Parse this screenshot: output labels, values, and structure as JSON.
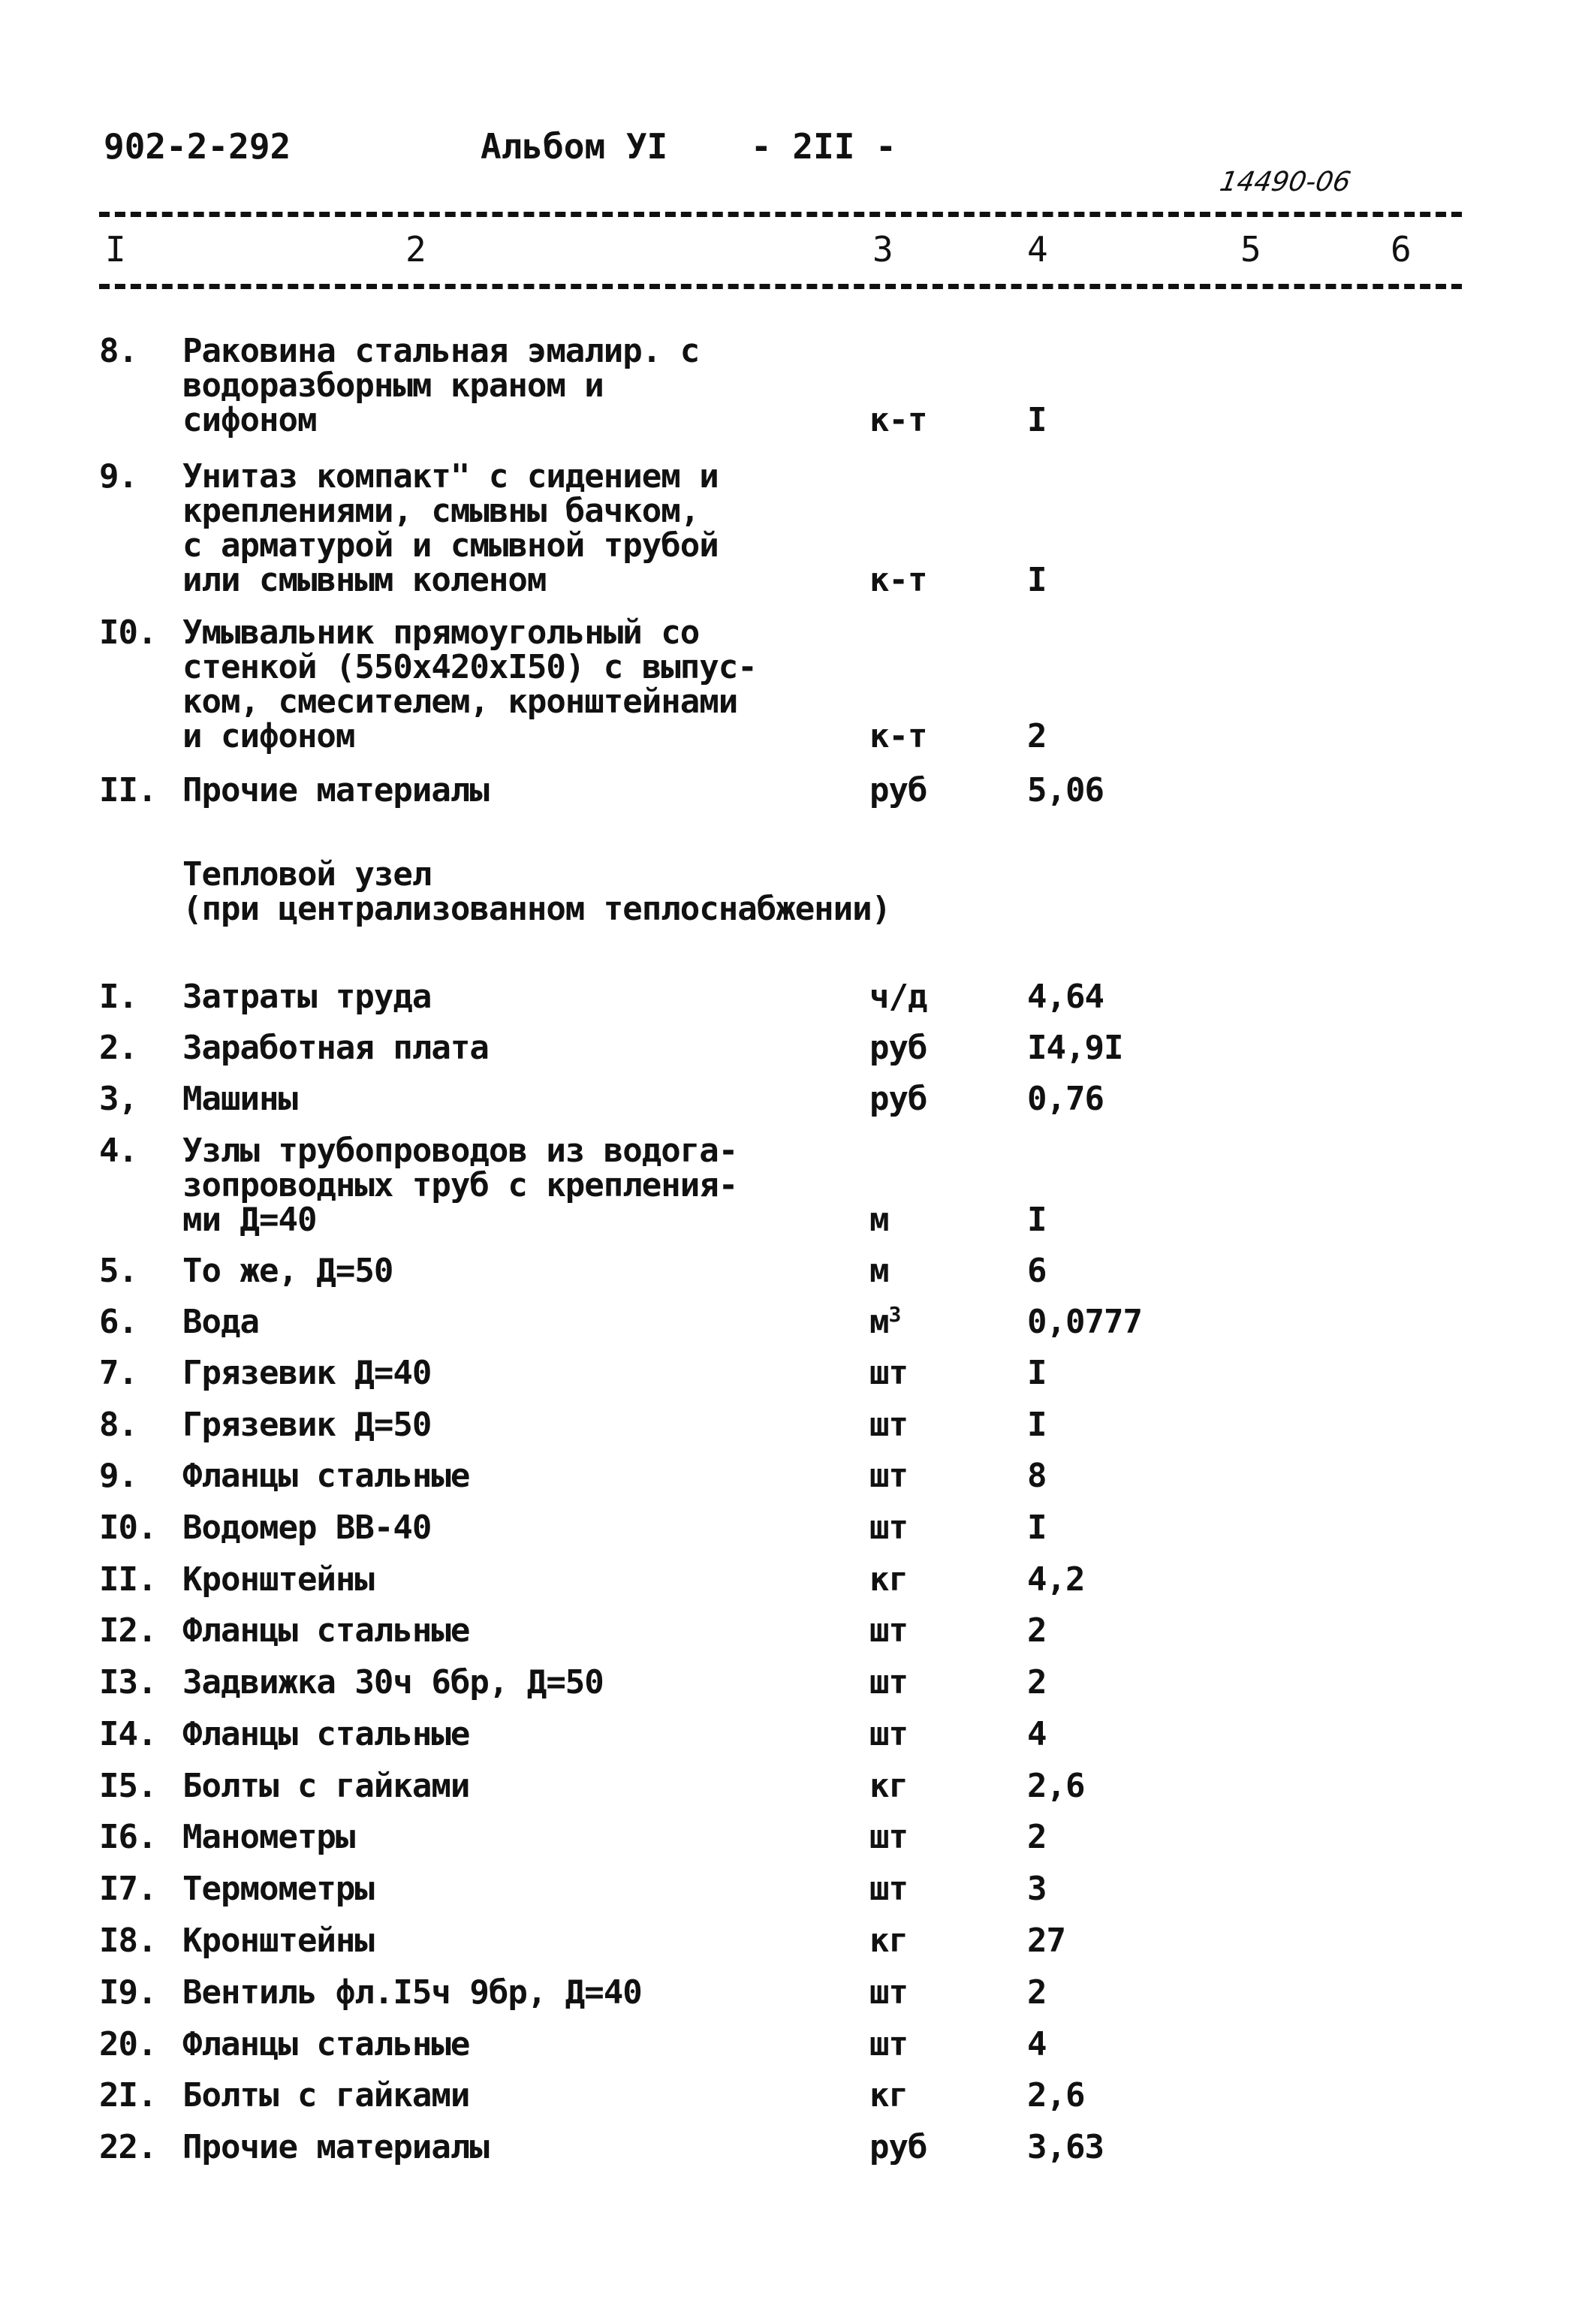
{
  "header": {
    "doc_code": "902-2-292",
    "album": "Альбом УI",
    "page": "- 2II -",
    "stamp": "14490-06"
  },
  "columns": [
    "I",
    "2",
    "3",
    "4",
    "5",
    "6"
  ],
  "section1": {
    "rows": [
      {
        "num": "8.",
        "lines": [
          "Раковина стальная эмалир. с",
          "водоразборным краном и",
          "сифоном"
        ],
        "unit": "к-т",
        "value": "I"
      },
      {
        "num": "9.",
        "lines": [
          "Унитаз компакт\" с сидением и",
          "креплениями, смывны бачком,",
          "с арматурой и смывной трубой",
          "или смывным коленом"
        ],
        "unit": "к-т",
        "value": "I"
      },
      {
        "num": "I0.",
        "lines": [
          "Умывальник прямоугольный со",
          "стенкой (550х420хI50) с выпус-",
          "ком, смесителем, кронштейнами",
          "и сифоном"
        ],
        "unit": "к-т",
        "value": "2"
      },
      {
        "num": "II.",
        "lines": [
          "Прочие материалы"
        ],
        "unit": "руб",
        "value": "5,06"
      }
    ]
  },
  "section2": {
    "title_lines": [
      "Тепловой узел",
      "(при централизованном теплоснабжении)"
    ],
    "rows": [
      {
        "num": "I.",
        "lines": [
          "Затраты труда"
        ],
        "unit": "ч/д",
        "value": "4,64"
      },
      {
        "num": "2.",
        "lines": [
          "Заработная плата"
        ],
        "unit": "руб",
        "value": "I4,9I"
      },
      {
        "num": "3,",
        "lines": [
          "Машины"
        ],
        "unit": "руб",
        "value": "0,76"
      },
      {
        "num": "4.",
        "lines": [
          "Узлы трубопроводов из водога-",
          "зопроводных труб с крепления-",
          "ми Д=40"
        ],
        "unit": "м",
        "value": "I"
      },
      {
        "num": "5.",
        "lines": [
          "То же, Д=50"
        ],
        "unit": "м",
        "value": "6"
      },
      {
        "num": "6.",
        "lines": [
          "Вода"
        ],
        "unit": "м",
        "unit_sup": "3",
        "value": "0,0777"
      },
      {
        "num": "7.",
        "lines": [
          "Грязевик Д=40"
        ],
        "unit": "шт",
        "value": "I"
      },
      {
        "num": "8.",
        "lines": [
          "Грязевик Д=50"
        ],
        "unit": "шт",
        "value": "I"
      },
      {
        "num": "9.",
        "lines": [
          "Фланцы стальные"
        ],
        "unit": "шт",
        "value": "8"
      },
      {
        "num": "I0.",
        "lines": [
          "Водомер ВВ-40"
        ],
        "unit": "шт",
        "value": "I"
      },
      {
        "num": "II.",
        "lines": [
          "Кронштейны"
        ],
        "unit": "кг",
        "value": "4,2"
      },
      {
        "num": "I2.",
        "lines": [
          "Фланцы стальные"
        ],
        "unit": "шт",
        "value": "2"
      },
      {
        "num": "I3.",
        "lines": [
          "Задвижка 30ч 6бр, Д=50"
        ],
        "unit": "шт",
        "value": "2"
      },
      {
        "num": "I4.",
        "lines": [
          "Фланцы стальные"
        ],
        "unit": "шт",
        "value": "4"
      },
      {
        "num": "I5.",
        "lines": [
          "Болты с гайками"
        ],
        "unit": "кг",
        "value": "2,6"
      },
      {
        "num": "I6.",
        "lines": [
          "Манометры"
        ],
        "unit": "шт",
        "value": "2"
      },
      {
        "num": "I7.",
        "lines": [
          "Термометры"
        ],
        "unit": "шт",
        "value": "3"
      },
      {
        "num": "I8.",
        "lines": [
          "Кронштейны"
        ],
        "unit": "кг",
        "value": "27"
      },
      {
        "num": "I9.",
        "lines": [
          "Вентиль фл.I5ч 9бр, Д=40"
        ],
        "unit": "шт",
        "value": "2"
      },
      {
        "num": "20.",
        "lines": [
          "Фланцы стальные"
        ],
        "unit": "шт",
        "value": "4"
      },
      {
        "num": "2I.",
        "lines": [
          "Болты с гайками"
        ],
        "unit": "кг",
        "value": "2,6"
      },
      {
        "num": "22.",
        "lines": [
          "Прочие материалы"
        ],
        "unit": "руб",
        "value": "3,63"
      }
    ]
  }
}
